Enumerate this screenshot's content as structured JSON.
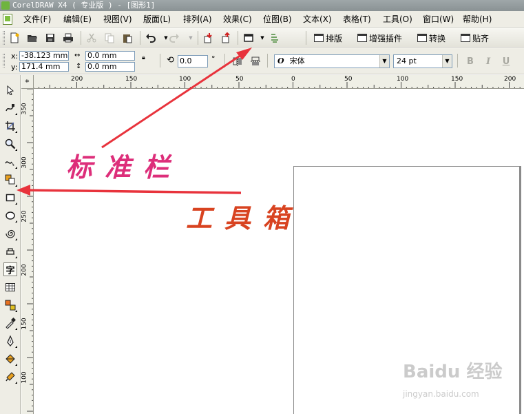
{
  "window": {
    "title": "CorelDRAW X4 ( 专业版 ) - [图形1]"
  },
  "menubar": {
    "items": [
      {
        "label": "文件(F)",
        "name": "menu-file"
      },
      {
        "label": "编辑(E)",
        "name": "menu-edit"
      },
      {
        "label": "视图(V)",
        "name": "menu-view"
      },
      {
        "label": "版面(L)",
        "name": "menu-layout"
      },
      {
        "label": "排列(A)",
        "name": "menu-arrange"
      },
      {
        "label": "效果(C)",
        "name": "menu-effects"
      },
      {
        "label": "位图(B)",
        "name": "menu-bitmaps"
      },
      {
        "label": "文本(X)",
        "name": "menu-text"
      },
      {
        "label": "表格(T)",
        "name": "menu-table"
      },
      {
        "label": "工具(O)",
        "name": "menu-tools"
      },
      {
        "label": "窗口(W)",
        "name": "menu-window"
      },
      {
        "label": "帮助(H)",
        "name": "menu-help"
      }
    ]
  },
  "standard_toolbar": {
    "icons": [
      "new-document-icon",
      "open-icon",
      "save-icon",
      "print-icon",
      "cut-icon",
      "copy-icon",
      "paste-icon",
      "undo-icon",
      "redo-icon",
      "import-icon",
      "export-icon",
      "app-launcher-icon",
      "zoom-levels-icon"
    ],
    "plugins": [
      {
        "label": "排版",
        "name": "typeset-button"
      },
      {
        "label": "增强插件",
        "name": "enhance-plugin-button"
      },
      {
        "label": "转换",
        "name": "convert-button"
      },
      {
        "label": "贴齐",
        "name": "snap-button"
      }
    ]
  },
  "property_bar": {
    "x_label": "x:",
    "y_label": "y:",
    "x_value": "-38.123 mm",
    "y_value": "171.4 mm",
    "width_value": "0.0 mm",
    "height_value": "0.0 mm",
    "rotation_value": "0.0",
    "degree_symbol": "°",
    "font_icon": "O",
    "font_name": "宋体",
    "font_size": "24 pt",
    "bold_label": "B",
    "italic_label": "I",
    "underline_label": "U"
  },
  "toolbox": {
    "tools": [
      "pick-tool-icon",
      "shape-tool-icon",
      "crop-tool-icon",
      "zoom-tool-icon",
      "freehand-tool-icon",
      "smart-fill-tool-icon",
      "rectangle-tool-icon",
      "ellipse-tool-icon",
      "spiral-tool-icon",
      "basic-shapes-tool-icon",
      "text-tool-icon",
      "table-tool-icon",
      "interactive-blend-tool-icon",
      "eyedropper-tool-icon",
      "outline-tool-icon",
      "fill-tool-icon",
      "interactive-fill-tool-icon"
    ],
    "text_tool_glyph": "字",
    "active_tool": "text-tool-icon"
  },
  "ruler": {
    "horizontal_labels": [
      "200",
      "150",
      "100",
      "50",
      "0",
      "50",
      "100",
      "150",
      "200"
    ],
    "vertical_labels": [
      "350",
      "300",
      "250",
      "200",
      "150",
      "100"
    ]
  },
  "annotations": {
    "standard_bar": "标准栏",
    "toolbox": "工具箱"
  },
  "watermark": {
    "main": "Baidu 经验",
    "sub": "jingyan.baidu.com"
  },
  "colors": {
    "annotation_pink": "#dd2e7a",
    "annotation_orange": "#d84320",
    "arrow_red": "#e8333c"
  }
}
